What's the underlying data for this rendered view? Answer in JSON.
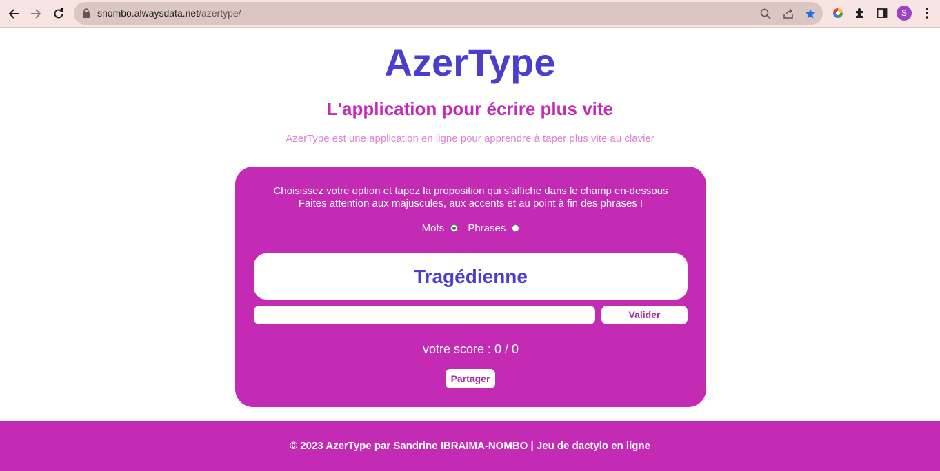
{
  "browser": {
    "url_host": "snombo.alwaysdata.net",
    "url_path": "/azertype/",
    "profile_initial": "S"
  },
  "header": {
    "title": "AzerType",
    "subtitle": "L'application pour écrire plus vite",
    "description": "AzerType est une application en ligne pour apprendre à taper plus vite au clavier"
  },
  "game": {
    "instruction_line1": "Choisissez votre option et tapez la proposition qui s'affiche dans le champ en-dessous",
    "instruction_line2": "Faites attention aux majuscules, aux accents et au point à fin des phrases !",
    "options": [
      {
        "label": "Mots",
        "checked": true
      },
      {
        "label": "Phrases",
        "checked": false
      }
    ],
    "proposal": "Tragédienne",
    "input_value": "",
    "validate_label": "Valider",
    "score_text": "votre score : 0 / 0",
    "share_label": "Partager"
  },
  "footer": {
    "text": "© 2023 AzerType par Sandrine IBRAIMA-NOMBO | Jeu de dactylo en ligne"
  },
  "colors": {
    "primary": "#4b3ecf",
    "accent": "#c42bb4",
    "light_accent": "#e27fd6"
  }
}
